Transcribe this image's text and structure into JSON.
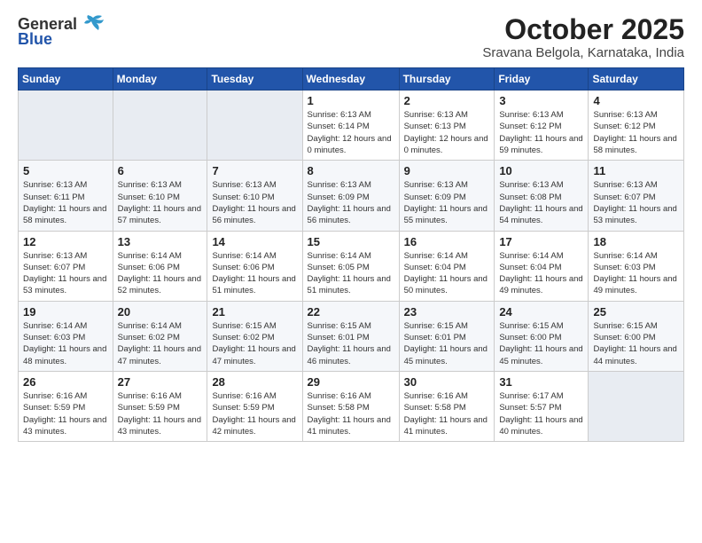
{
  "logo": {
    "general": "General",
    "blue": "Blue"
  },
  "title": {
    "month": "October 2025",
    "location": "Sravana Belgola, Karnataka, India"
  },
  "headers": [
    "Sunday",
    "Monday",
    "Tuesday",
    "Wednesday",
    "Thursday",
    "Friday",
    "Saturday"
  ],
  "weeks": [
    [
      {
        "day": "",
        "info": ""
      },
      {
        "day": "",
        "info": ""
      },
      {
        "day": "",
        "info": ""
      },
      {
        "day": "1",
        "info": "Sunrise: 6:13 AM\nSunset: 6:14 PM\nDaylight: 12 hours\nand 0 minutes."
      },
      {
        "day": "2",
        "info": "Sunrise: 6:13 AM\nSunset: 6:13 PM\nDaylight: 12 hours\nand 0 minutes."
      },
      {
        "day": "3",
        "info": "Sunrise: 6:13 AM\nSunset: 6:12 PM\nDaylight: 11 hours\nand 59 minutes."
      },
      {
        "day": "4",
        "info": "Sunrise: 6:13 AM\nSunset: 6:12 PM\nDaylight: 11 hours\nand 58 minutes."
      }
    ],
    [
      {
        "day": "5",
        "info": "Sunrise: 6:13 AM\nSunset: 6:11 PM\nDaylight: 11 hours\nand 58 minutes."
      },
      {
        "day": "6",
        "info": "Sunrise: 6:13 AM\nSunset: 6:10 PM\nDaylight: 11 hours\nand 57 minutes."
      },
      {
        "day": "7",
        "info": "Sunrise: 6:13 AM\nSunset: 6:10 PM\nDaylight: 11 hours\nand 56 minutes."
      },
      {
        "day": "8",
        "info": "Sunrise: 6:13 AM\nSunset: 6:09 PM\nDaylight: 11 hours\nand 56 minutes."
      },
      {
        "day": "9",
        "info": "Sunrise: 6:13 AM\nSunset: 6:09 PM\nDaylight: 11 hours\nand 55 minutes."
      },
      {
        "day": "10",
        "info": "Sunrise: 6:13 AM\nSunset: 6:08 PM\nDaylight: 11 hours\nand 54 minutes."
      },
      {
        "day": "11",
        "info": "Sunrise: 6:13 AM\nSunset: 6:07 PM\nDaylight: 11 hours\nand 53 minutes."
      }
    ],
    [
      {
        "day": "12",
        "info": "Sunrise: 6:13 AM\nSunset: 6:07 PM\nDaylight: 11 hours\nand 53 minutes."
      },
      {
        "day": "13",
        "info": "Sunrise: 6:14 AM\nSunset: 6:06 PM\nDaylight: 11 hours\nand 52 minutes."
      },
      {
        "day": "14",
        "info": "Sunrise: 6:14 AM\nSunset: 6:06 PM\nDaylight: 11 hours\nand 51 minutes."
      },
      {
        "day": "15",
        "info": "Sunrise: 6:14 AM\nSunset: 6:05 PM\nDaylight: 11 hours\nand 51 minutes."
      },
      {
        "day": "16",
        "info": "Sunrise: 6:14 AM\nSunset: 6:04 PM\nDaylight: 11 hours\nand 50 minutes."
      },
      {
        "day": "17",
        "info": "Sunrise: 6:14 AM\nSunset: 6:04 PM\nDaylight: 11 hours\nand 49 minutes."
      },
      {
        "day": "18",
        "info": "Sunrise: 6:14 AM\nSunset: 6:03 PM\nDaylight: 11 hours\nand 49 minutes."
      }
    ],
    [
      {
        "day": "19",
        "info": "Sunrise: 6:14 AM\nSunset: 6:03 PM\nDaylight: 11 hours\nand 48 minutes."
      },
      {
        "day": "20",
        "info": "Sunrise: 6:14 AM\nSunset: 6:02 PM\nDaylight: 11 hours\nand 47 minutes."
      },
      {
        "day": "21",
        "info": "Sunrise: 6:15 AM\nSunset: 6:02 PM\nDaylight: 11 hours\nand 47 minutes."
      },
      {
        "day": "22",
        "info": "Sunrise: 6:15 AM\nSunset: 6:01 PM\nDaylight: 11 hours\nand 46 minutes."
      },
      {
        "day": "23",
        "info": "Sunrise: 6:15 AM\nSunset: 6:01 PM\nDaylight: 11 hours\nand 45 minutes."
      },
      {
        "day": "24",
        "info": "Sunrise: 6:15 AM\nSunset: 6:00 PM\nDaylight: 11 hours\nand 45 minutes."
      },
      {
        "day": "25",
        "info": "Sunrise: 6:15 AM\nSunset: 6:00 PM\nDaylight: 11 hours\nand 44 minutes."
      }
    ],
    [
      {
        "day": "26",
        "info": "Sunrise: 6:16 AM\nSunset: 5:59 PM\nDaylight: 11 hours\nand 43 minutes."
      },
      {
        "day": "27",
        "info": "Sunrise: 6:16 AM\nSunset: 5:59 PM\nDaylight: 11 hours\nand 43 minutes."
      },
      {
        "day": "28",
        "info": "Sunrise: 6:16 AM\nSunset: 5:59 PM\nDaylight: 11 hours\nand 42 minutes."
      },
      {
        "day": "29",
        "info": "Sunrise: 6:16 AM\nSunset: 5:58 PM\nDaylight: 11 hours\nand 41 minutes."
      },
      {
        "day": "30",
        "info": "Sunrise: 6:16 AM\nSunset: 5:58 PM\nDaylight: 11 hours\nand 41 minutes."
      },
      {
        "day": "31",
        "info": "Sunrise: 6:17 AM\nSunset: 5:57 PM\nDaylight: 11 hours\nand 40 minutes."
      },
      {
        "day": "",
        "info": ""
      }
    ]
  ]
}
